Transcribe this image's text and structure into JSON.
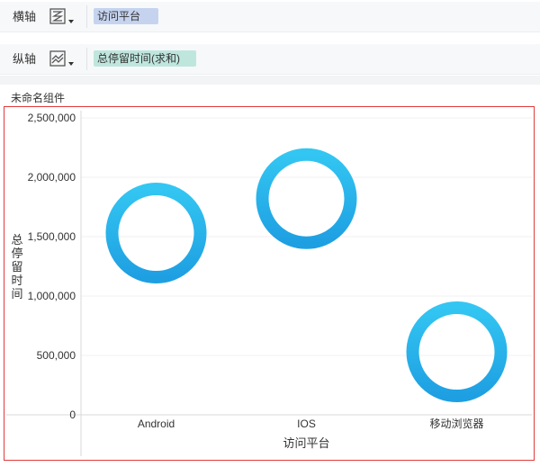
{
  "shelves": {
    "x": {
      "label": "横轴",
      "icon": "bubble-chart-icon",
      "field": "访问平台"
    },
    "y": {
      "label": "纵轴",
      "icon": "line-area-chart-icon",
      "field": "总停留时间(求和)"
    }
  },
  "widget": {
    "title": "未命名组件"
  },
  "colors": {
    "accent": "#2fb3ea",
    "frame_border": "#e23b3b",
    "x_pill": "#c5d3ef",
    "y_pill": "#bfe6dd"
  },
  "chart_data": {
    "type": "scatter",
    "marker": "ring",
    "categories": [
      "Android",
      "IOS",
      "移动浏览器"
    ],
    "values": [
      1530000,
      1820000,
      530000
    ],
    "xlabel": "访问平台",
    "ylabel": "总停留时间",
    "ylim": [
      0,
      2500000
    ],
    "yticks": [
      0,
      500000,
      1000000,
      1500000,
      2000000,
      2500000
    ],
    "ytick_labels": [
      "0",
      "500,000",
      "1,000,000",
      "1,500,000",
      "2,000,000",
      "2,500,000"
    ],
    "grid": true
  }
}
